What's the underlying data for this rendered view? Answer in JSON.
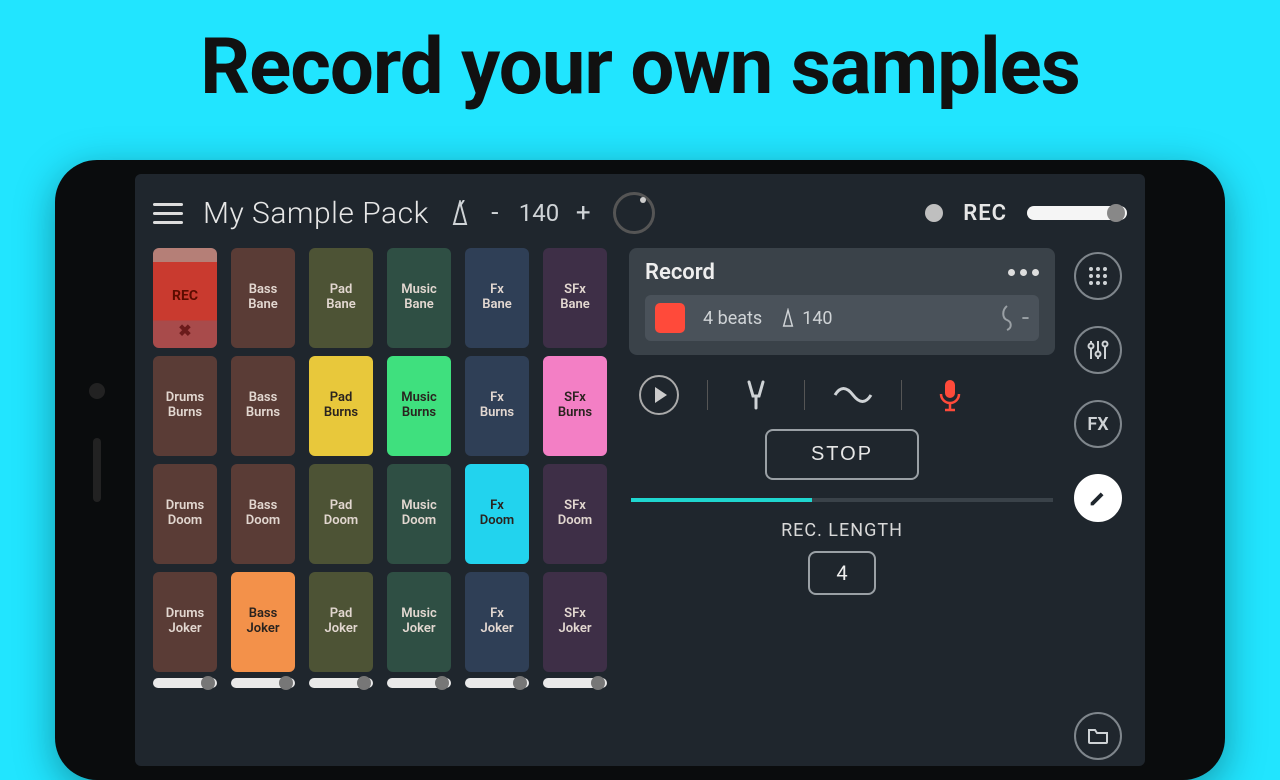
{
  "headline": "Record your own samples",
  "topbar": {
    "title": "My Sample Pack",
    "tempo": "140",
    "rec_label": "REC"
  },
  "pads": {
    "columns": [
      "Drums",
      "Bass",
      "Pad",
      "Music",
      "Fx",
      "SFx"
    ],
    "rows": [
      "Bane",
      "Burns",
      "Doom",
      "Joker"
    ],
    "rec_pad_label": "REC",
    "colors": {
      "r0": [
        "#5a3c36",
        "#5a3c36",
        "#4d5335",
        "#2f4f44",
        "#2f3f56",
        "#3e2f47"
      ],
      "r1": [
        "#5a3c36",
        "#5a3c36",
        "#e8c83b",
        "#3fe07e",
        "#2f3f56",
        "#f37fc5"
      ],
      "r2": [
        "#5a3c36",
        "#5a3c36",
        "#4d5335",
        "#2f4f44",
        "#22d3ee",
        "#3e2f47"
      ],
      "r3": [
        "#5a3c36",
        "#f3914a",
        "#4d5335",
        "#2f4f44",
        "#2f3f56",
        "#3e2f47"
      ]
    },
    "text_dark": {
      "r1": [
        false,
        false,
        true,
        true,
        false,
        true
      ],
      "r2": [
        false,
        false,
        false,
        false,
        true,
        false
      ],
      "r3": [
        false,
        true,
        false,
        false,
        false,
        false
      ]
    }
  },
  "record_card": {
    "title": "Record",
    "beats": "4 beats",
    "tempo": "140",
    "clef_suffix": "-"
  },
  "controls": {
    "stop_label": "STOP",
    "length_label": "REC. LENGTH",
    "length_value": "4"
  },
  "side": {
    "fx_label": "FX"
  }
}
